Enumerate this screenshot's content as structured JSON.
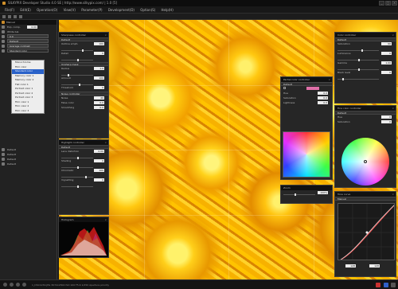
{
  "window": {
    "title": "SILKYPIX Developer Studio 4.0 SE | http://www.silkypix.com/ | 1.0 [5]"
  },
  "menu": [
    "File(F)",
    "Edit(E)",
    "Operation(O)",
    "View(V)",
    "Parameter(P)",
    "Development(D)",
    "Option(S)",
    "Help(H)"
  ],
  "left_panel": {
    "head": "Manual",
    "rows": [
      {
        "label": "Exp. comp.",
        "value": "0.00"
      },
      {
        "label": "White bal.",
        "value": ""
      },
      {
        "label": "0.0",
        "value": ""
      },
      {
        "label": "Default",
        "value": ""
      },
      {
        "label": "Average contrast",
        "value": ""
      },
      {
        "label": "Standard color",
        "value": ""
      }
    ],
    "menu_items": [
      "Monochrome",
      "Film color",
      "Standard color",
      "Memory color 1",
      "Memory color 2",
      "Flat color 1",
      "Portrait color 1",
      "Portrait color 2",
      "Portrait color 3",
      "Film color 1",
      "Film color 2",
      "Film color 3"
    ],
    "menu_selected": "Standard color",
    "extra_rows": [
      "Default",
      "Default",
      "Default",
      "Default"
    ]
  },
  "panels": {
    "sharpness": {
      "title": "Sharpness controller",
      "preset": "Default",
      "rows": [
        {
          "label": "Outline emph.",
          "value": "100"
        },
        {
          "label": "Detail",
          "value": "0"
        },
        {
          "label": "Unsharp mask",
          "value": ""
        },
        {
          "label": "Radius",
          "value": "1.0"
        },
        {
          "label": "Amount",
          "value": "100"
        },
        {
          "label": "Threshold",
          "value": "0"
        }
      ]
    },
    "noise": {
      "title": "Noise controller",
      "rows": [
        {
          "label": "Noise",
          "value": "40"
        },
        {
          "label": "False color",
          "value": "0.0"
        },
        {
          "label": "Smoothing",
          "value": "0.0"
        }
      ]
    },
    "highlight": {
      "title": "Highlight controller",
      "preset": "Default",
      "rows": [
        {
          "label": "Lens distortion",
          "value": "0.00"
        },
        {
          "label": "Shading",
          "value": "0"
        },
        {
          "label": "Chromatic",
          "value": "100"
        },
        {
          "label": "Vignetting",
          "value": "0"
        }
      ]
    },
    "histogram": {
      "title": "Histogram"
    },
    "partial_color": {
      "title": "Partial color controller",
      "preset": "Default",
      "rows": [
        {
          "label": "Hue",
          "value": "0.0"
        },
        {
          "label": "Saturation",
          "value": "0.0"
        },
        {
          "label": "Lightness",
          "value": "0.0"
        }
      ]
    },
    "color": {
      "title": "Color controller",
      "preset": "Default",
      "rows": [
        {
          "label": "Saturation",
          "value": "90"
        },
        {
          "label": "Luminance",
          "value": "0"
        },
        {
          "label": "Gamma",
          "value": "1.00"
        },
        {
          "label": "Black level",
          "value": "0"
        }
      ]
    },
    "fine_color": {
      "title": "Fine color controller",
      "preset": "Default",
      "rows": [
        {
          "label": "Hue",
          "value": "0"
        },
        {
          "label": "Saturation",
          "value": "0"
        }
      ]
    },
    "tone": {
      "title": "Tone curve",
      "preset": "Manual"
    },
    "zoom": {
      "title": "Zoom",
      "value": "100%"
    }
  },
  "status": {
    "text": "1_DSC1234.JPG  3072x2304  ISO 100  F5.6  1/250  Aperture priority"
  }
}
